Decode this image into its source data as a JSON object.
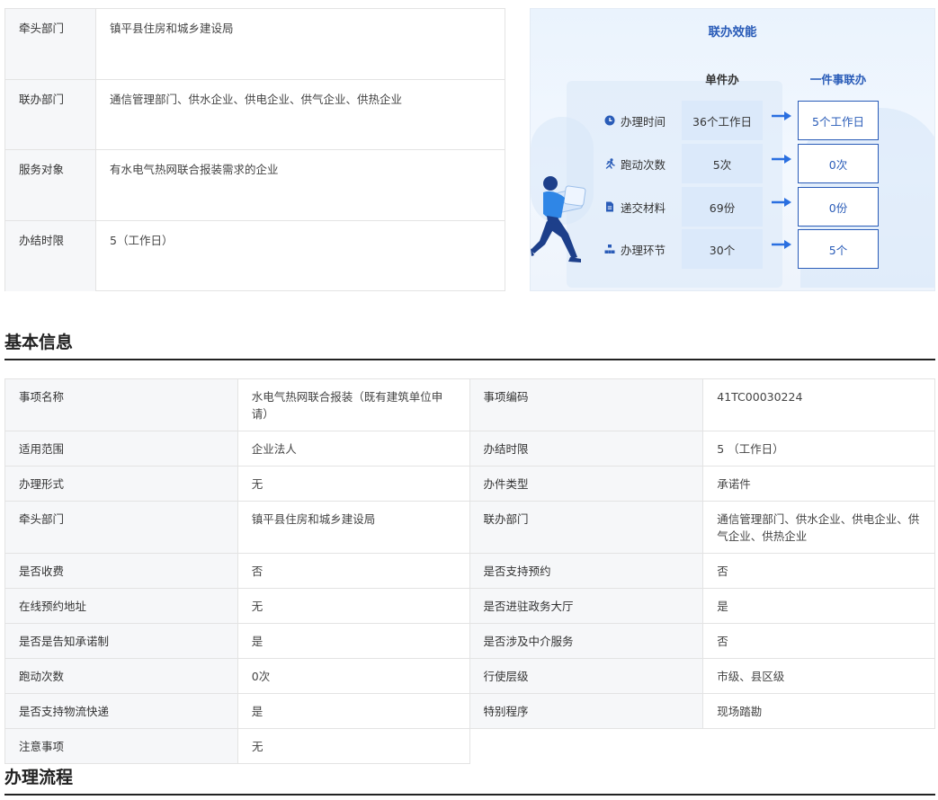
{
  "summary": [
    {
      "label": "牵头部门",
      "value": "镇平县住房和城乡建设局"
    },
    {
      "label": "联办部门",
      "value": "通信管理部门、供水企业、供电企业、供气企业、供热企业"
    },
    {
      "label": "服务对象",
      "value": "有水电气热网联合报装需求的企业"
    },
    {
      "label": "办结时限",
      "value": "5（工作日）"
    }
  ],
  "efficiency": {
    "title": "联办效能",
    "col_single": "单件办",
    "col_joint": "一件事联办",
    "rows": [
      {
        "icon": "clock-icon",
        "label": "办理时间",
        "single": "36个工作日",
        "joint": "5个工作日"
      },
      {
        "icon": "runner-icon",
        "label": "跑动次数",
        "single": "5次",
        "joint": "0次"
      },
      {
        "icon": "document-icon",
        "label": "递交材料",
        "single": "69份",
        "joint": "0份"
      },
      {
        "icon": "flowchart-icon",
        "label": "办理环节",
        "single": "30个",
        "joint": "5个"
      }
    ],
    "accent": "#2a5cb8"
  },
  "sections": {
    "basic": "基本信息",
    "process": "办理流程"
  },
  "info": [
    [
      {
        "k": "事项名称",
        "v": "水电气热网联合报装（既有建筑单位申请）"
      },
      {
        "k": "事项编码",
        "v": "41TC00030224"
      }
    ],
    [
      {
        "k": "适用范围",
        "v": "企业法人"
      },
      {
        "k": "办结时限",
        "v": "5 （工作日）"
      }
    ],
    [
      {
        "k": "办理形式",
        "v": "无"
      },
      {
        "k": "办件类型",
        "v": "承诺件"
      }
    ],
    [
      {
        "k": "牵头部门",
        "v": "镇平县住房和城乡建设局"
      },
      {
        "k": "联办部门",
        "v": "通信管理部门、供水企业、供电企业、供气企业、供热企业"
      }
    ],
    [
      {
        "k": "是否收费",
        "v": "否"
      },
      {
        "k": "是否支持预约",
        "v": "否"
      }
    ],
    [
      {
        "k": "在线预约地址",
        "v": "无"
      },
      {
        "k": "是否进驻政务大厅",
        "v": "是"
      }
    ],
    [
      {
        "k": "是否是告知承诺制",
        "v": "是"
      },
      {
        "k": "是否涉及中介服务",
        "v": "否"
      }
    ],
    [
      {
        "k": "跑动次数",
        "v": "0次"
      },
      {
        "k": "行使层级",
        "v": "市级、县区级"
      }
    ],
    [
      {
        "k": "是否支持物流快递",
        "v": "是"
      },
      {
        "k": "特别程序",
        "v": "现场踏勘"
      }
    ],
    [
      {
        "k": "注意事项",
        "v": "无"
      }
    ]
  ]
}
